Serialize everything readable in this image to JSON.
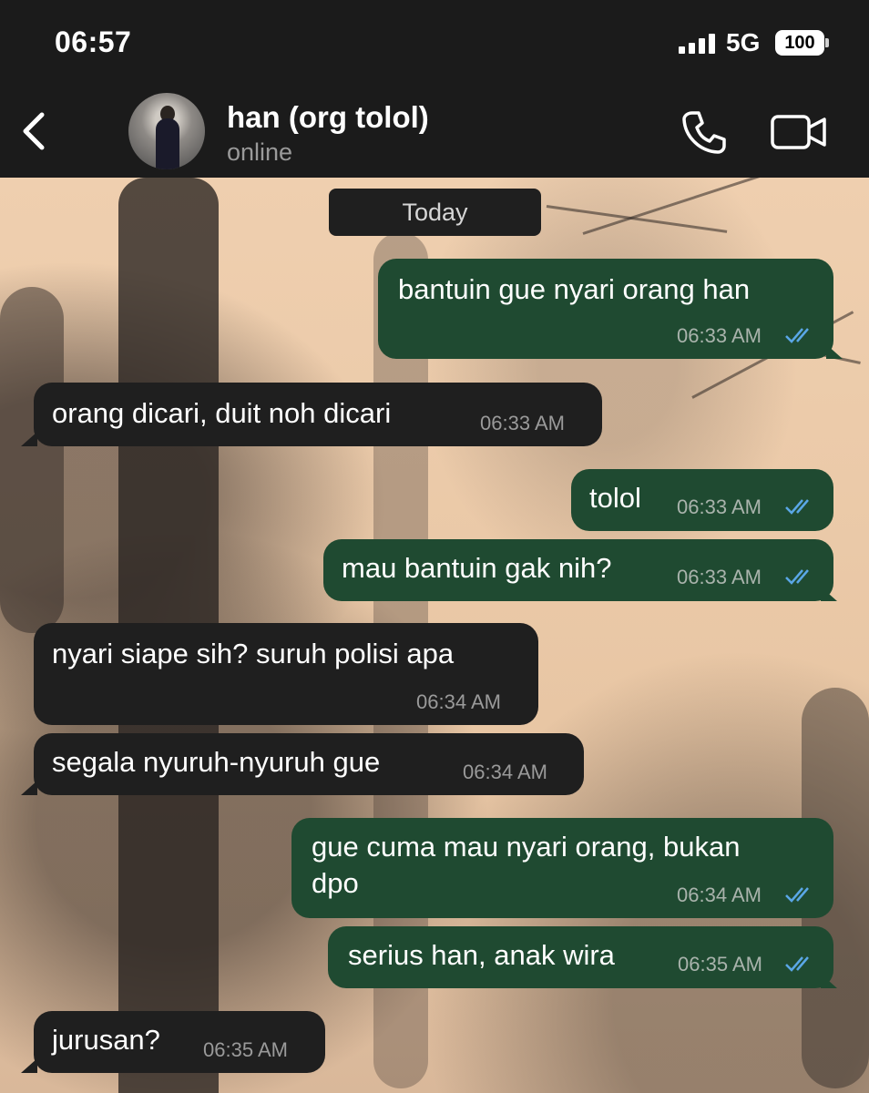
{
  "status_bar": {
    "time": "06:57",
    "network": "5G",
    "battery": "100"
  },
  "header": {
    "contact_name": "han (org tolol)",
    "contact_status": "online"
  },
  "date_separator": "Today",
  "messages": [
    {
      "direction": "out",
      "text": "bantuin gue nyari orang han",
      "time": "06:33 AM",
      "read": true
    },
    {
      "direction": "in",
      "text": "orang dicari, duit noh dicari",
      "time": "06:33 AM"
    },
    {
      "direction": "out",
      "text": "tolol",
      "time": "06:33 AM",
      "read": true
    },
    {
      "direction": "out",
      "text": "mau bantuin gak nih?",
      "time": "06:33 AM",
      "read": true
    },
    {
      "direction": "in",
      "text": "nyari siape sih? suruh polisi apa",
      "time": "06:34 AM"
    },
    {
      "direction": "in",
      "text": "segala nyuruh-nyuruh gue",
      "time": "06:34 AM"
    },
    {
      "direction": "out",
      "text": "gue cuma mau nyari orang, bukan",
      "text_line2": "dpo",
      "time": "06:34 AM",
      "read": true
    },
    {
      "direction": "out",
      "text": "serius han, anak wira",
      "time": "06:35 AM",
      "read": true
    },
    {
      "direction": "in",
      "text": "jurusan?",
      "time": "06:35 AM"
    }
  ],
  "colors": {
    "outgoing_bubble": "#1f4a31",
    "incoming_bubble": "#1f1f1f",
    "read_ticks": "#5aa7e6"
  },
  "icons": {
    "back": "chevron-left-icon",
    "call": "phone-icon",
    "video": "video-camera-icon",
    "read": "double-check-icon"
  }
}
